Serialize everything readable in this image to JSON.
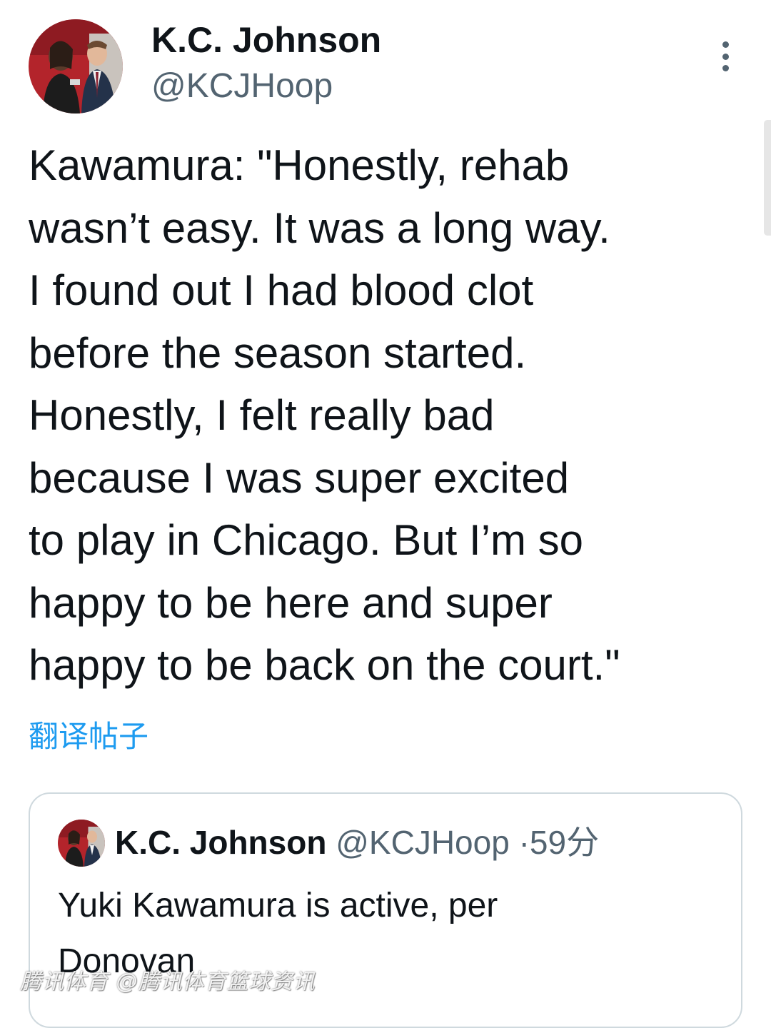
{
  "author": {
    "display_name": "K.C. Johnson",
    "handle": "@KCJHoop",
    "avatar_icon": "profile-photo"
  },
  "more_icon": "more-vertical-icon",
  "tweet": {
    "text": "Kawamura: \"Honestly, rehab\nwasn’t easy. It was a long way.\nI found out I had blood clot\nbefore the season started.\nHonestly, I felt really bad\nbecause I was super excited\nto play in Chicago. But I’m so\nhappy to be here and super\nhappy to be back on the court.\"",
    "translate_label": "翻译帖子"
  },
  "quoted_tweet": {
    "display_name": "K.C. Johnson",
    "handle": "@KCJHoop",
    "separator": "·",
    "time": "59分",
    "text": "Yuki Kawamura is active, per Donovan"
  },
  "watermark": "腾讯体育 @腾讯体育篮球资讯",
  "colors": {
    "link": "#1d9bf0",
    "secondary_text": "#536471",
    "primary_text": "#0f1419",
    "border": "#cfd9de"
  }
}
